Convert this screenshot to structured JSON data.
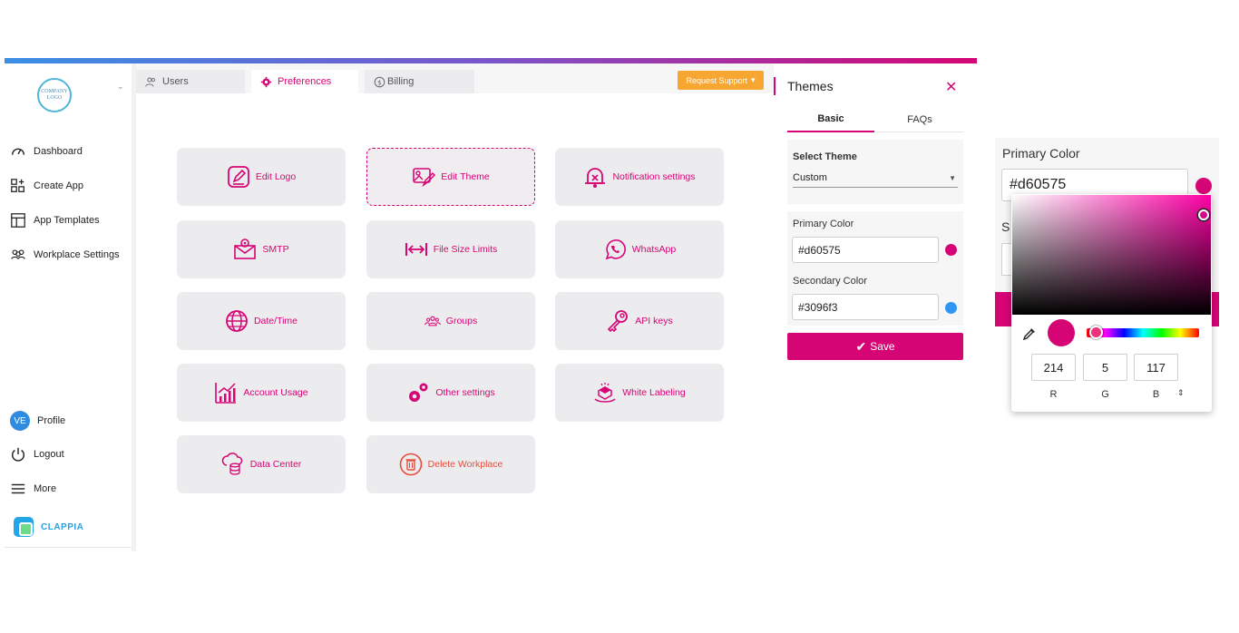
{
  "colors": {
    "brand": "#d60575",
    "secondary": "#3096f3",
    "support": "#f7a731",
    "danger": "#e74c3c"
  },
  "sidebar": {
    "logo_text": "COMPANY LOGO",
    "items": [
      {
        "label": "Dashboard",
        "icon": "gauge-icon"
      },
      {
        "label": "Create App",
        "icon": "apps-add-icon"
      },
      {
        "label": "App Templates",
        "icon": "templates-icon"
      },
      {
        "label": "Workplace Settings",
        "icon": "users-group-icon"
      }
    ],
    "profile": {
      "initials": "VE",
      "label": "Profile"
    },
    "logout_label": "Logout",
    "more_label": "More",
    "brand_name": "CLAPPIA"
  },
  "tabs": [
    {
      "label": "Users",
      "icon": "users-icon"
    },
    {
      "label": "Preferences",
      "icon": "gear-icon"
    },
    {
      "label": "Billing",
      "icon": "dollar-icon"
    }
  ],
  "support_button": "Request Support",
  "cards": [
    {
      "label": "Edit Logo",
      "icon": "edit-icon"
    },
    {
      "label": "Edit Theme",
      "icon": "theme-icon"
    },
    {
      "label": "Notification settings",
      "icon": "bell-icon"
    },
    {
      "label": "SMTP",
      "icon": "mail-icon"
    },
    {
      "label": "File Size Limits",
      "icon": "arrows-width-icon"
    },
    {
      "label": "WhatsApp",
      "icon": "whatsapp-icon"
    },
    {
      "label": "Date/Time",
      "icon": "globe-icon"
    },
    {
      "label": "Groups",
      "icon": "group-icon"
    },
    {
      "label": "API keys",
      "icon": "key-icon"
    },
    {
      "label": "Account Usage",
      "icon": "chart-icon"
    },
    {
      "label": "Other settings",
      "icon": "gears-icon"
    },
    {
      "label": "White Labeling",
      "icon": "white-label-icon"
    },
    {
      "label": "Data Center",
      "icon": "cloud-database-icon"
    },
    {
      "label": "Delete Workplace",
      "icon": "trash-icon"
    }
  ],
  "themes": {
    "title": "Themes",
    "tabs": [
      "Basic",
      "FAQs"
    ],
    "select_label": "Select Theme",
    "select_value": "Custom",
    "primary_label": "Primary Color",
    "primary_value": "#d60575",
    "secondary_label": "Secondary Color",
    "secondary_value": "#3096f3",
    "save_label": "Save"
  },
  "zoom": {
    "primary_label": "Primary Color",
    "primary_value": "#d60575",
    "secondary_initial": "S"
  },
  "picker": {
    "r": "214",
    "g": "5",
    "b": "117",
    "labels": [
      "R",
      "G",
      "B"
    ]
  }
}
